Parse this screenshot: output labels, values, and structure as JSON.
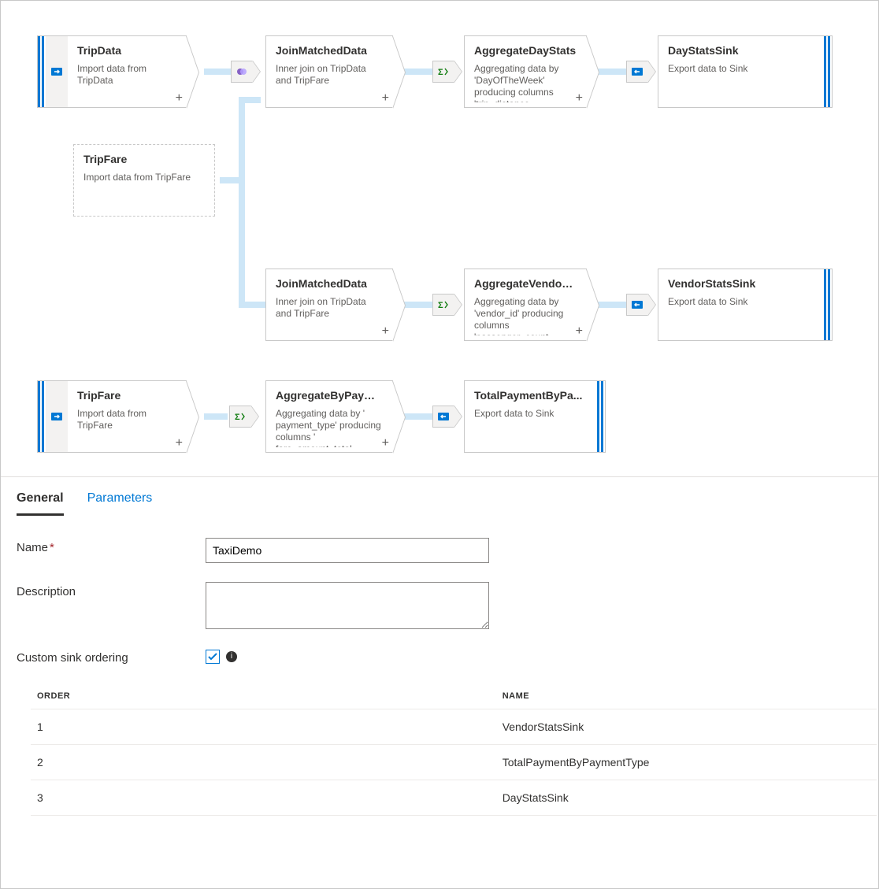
{
  "flow": {
    "nodes": {
      "tripdata": {
        "title": "TripData",
        "desc": "Import data from TripData"
      },
      "tripfare_g": {
        "title": "TripFare",
        "desc": "Import data from TripFare"
      },
      "join1": {
        "title": "JoinMatchedData",
        "desc": "Inner join on TripData and TripFare"
      },
      "aggday": {
        "title": "AggregateDayStats",
        "desc": "Aggregating data by 'DayOfTheWeek' producing columns 'trip_distance…"
      },
      "daysink": {
        "title": "DayStatsSink",
        "desc": "Export data to Sink"
      },
      "join2": {
        "title": "JoinMatchedData",
        "desc": "Inner join on TripData and TripFare"
      },
      "aggvendor": {
        "title": "AggregateVendorS...",
        "desc": "Aggregating data by 'vendor_id' producing columns 'passenger_count…"
      },
      "vendorsink": {
        "title": "VendorStatsSink",
        "desc": "Export data to Sink"
      },
      "tripfare2": {
        "title": "TripFare",
        "desc": "Import data from TripFare"
      },
      "aggpay": {
        "title": "AggregateByPaym...",
        "desc": "Aggregating data by ' payment_type' producing columns ' fare_amount_total…"
      },
      "paysink": {
        "title": "TotalPaymentByPa...",
        "desc": "Export data to Sink"
      }
    },
    "plus": "+"
  },
  "panel": {
    "tabs": {
      "general": "General",
      "parameters": "Parameters"
    },
    "labels": {
      "name": "Name",
      "description": "Description",
      "custom_sink": "Custom sink ordering"
    },
    "values": {
      "name": "TaxiDemo",
      "description": "",
      "custom_sink_checked": true
    },
    "table": {
      "headers": {
        "order": "ORDER",
        "name": "NAME"
      },
      "rows": [
        {
          "order": "1",
          "name": "VendorStatsSink"
        },
        {
          "order": "2",
          "name": "TotalPaymentByPaymentType"
        },
        {
          "order": "3",
          "name": "DayStatsSink"
        }
      ]
    }
  }
}
